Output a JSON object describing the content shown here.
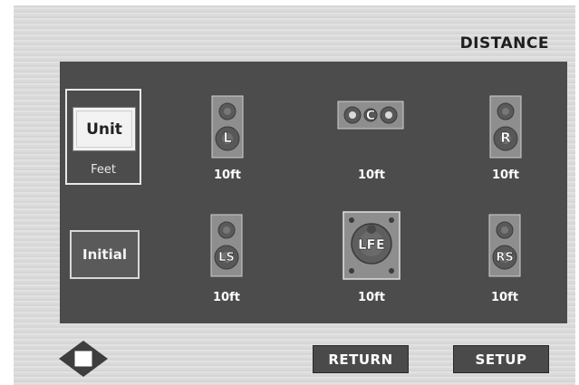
{
  "screen": {
    "title": "DISTANCE"
  },
  "unit": {
    "label": "Unit",
    "value": "Feet"
  },
  "initial": {
    "label": "Initial"
  },
  "speakers": {
    "front_left": {
      "id": "L",
      "distance": "10ft"
    },
    "center": {
      "id": "C",
      "distance": "10ft"
    },
    "front_right": {
      "id": "R",
      "distance": "10ft"
    },
    "surround_left": {
      "id": "LS",
      "distance": "10ft"
    },
    "subwoofer": {
      "id": "LFE",
      "distance": "10ft"
    },
    "surround_right": {
      "id": "RS",
      "distance": "10ft"
    }
  },
  "buttons": {
    "return": "RETURN",
    "setup": "SETUP"
  },
  "icons": {
    "navigation": "dpad-icon"
  },
  "colors": {
    "panel": "#4c4c4c",
    "button": "#4a4a4a"
  }
}
